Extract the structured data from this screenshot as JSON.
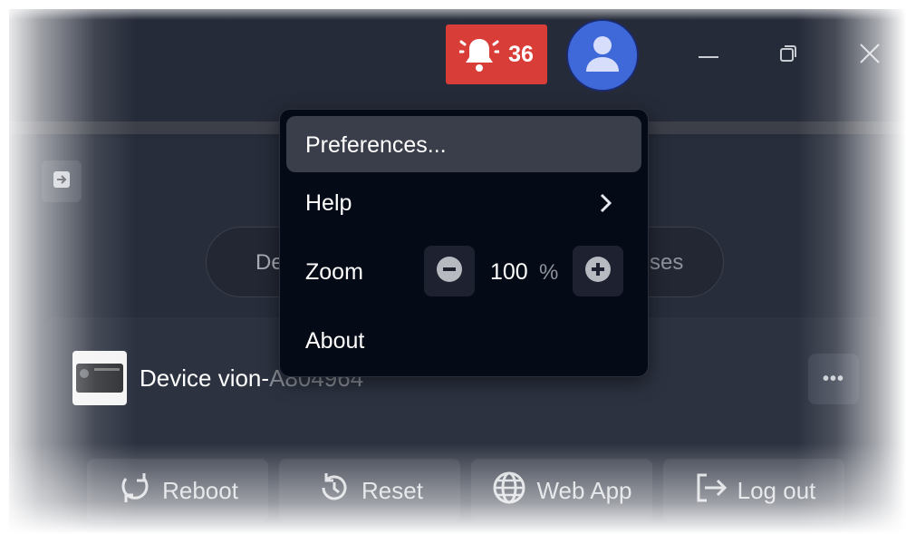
{
  "header": {
    "notifications": {
      "count": "36",
      "icon": "bell-icon",
      "color": "#d93d37"
    },
    "avatar": {
      "icon": "user-icon",
      "color": "#3f68d8"
    },
    "window_controls": [
      "minimize-icon",
      "restore-icon",
      "close-icon"
    ]
  },
  "sidebar": {
    "collapse_icon": "arrow-right-icon"
  },
  "tabs": {
    "left_visible_text": "De",
    "right_visible_text": "ses"
  },
  "device": {
    "name_visible": "Device vion-",
    "name_faded": "A804964",
    "more_label": "•••"
  },
  "actions": [
    {
      "label": "Reboot",
      "icon": "reboot-icon"
    },
    {
      "label": "Reset",
      "icon": "reset-icon"
    },
    {
      "label": "Web App",
      "icon": "globe-icon"
    },
    {
      "label": "Log out",
      "icon": "logout-icon"
    }
  ],
  "menu": {
    "preferences": "Preferences...",
    "help": "Help",
    "zoom": "Zoom",
    "zoom_value": "100",
    "zoom_unit": "%",
    "about": "About"
  }
}
